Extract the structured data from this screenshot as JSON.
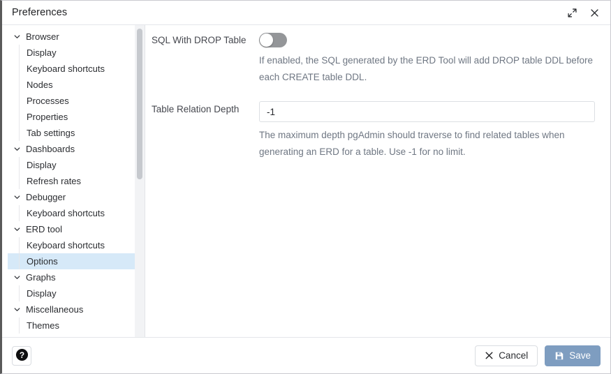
{
  "window": {
    "title": "Preferences",
    "expand_icon": "expand-icon",
    "close_icon": "close-icon"
  },
  "sidebar": {
    "tree": [
      {
        "label": "Browser",
        "type": "group",
        "expanded": true
      },
      {
        "label": "Display",
        "type": "child"
      },
      {
        "label": "Keyboard shortcuts",
        "type": "child"
      },
      {
        "label": "Nodes",
        "type": "child"
      },
      {
        "label": "Processes",
        "type": "child"
      },
      {
        "label": "Properties",
        "type": "child"
      },
      {
        "label": "Tab settings",
        "type": "child"
      },
      {
        "label": "Dashboards",
        "type": "group",
        "expanded": true
      },
      {
        "label": "Display",
        "type": "child"
      },
      {
        "label": "Refresh rates",
        "type": "child"
      },
      {
        "label": "Debugger",
        "type": "group",
        "expanded": true
      },
      {
        "label": "Keyboard shortcuts",
        "type": "child"
      },
      {
        "label": "ERD tool",
        "type": "group",
        "expanded": true
      },
      {
        "label": "Keyboard shortcuts",
        "type": "child"
      },
      {
        "label": "Options",
        "type": "child",
        "selected": true
      },
      {
        "label": "Graphs",
        "type": "group",
        "expanded": true
      },
      {
        "label": "Display",
        "type": "child"
      },
      {
        "label": "Miscellaneous",
        "type": "group",
        "expanded": true
      },
      {
        "label": "Themes",
        "type": "child"
      }
    ],
    "selected_accent": "#2c5f8e",
    "selected_background": "#d6e9f8"
  },
  "content": {
    "fields": [
      {
        "label": "SQL With DROP Table",
        "control": "toggle",
        "value": "off",
        "help": "If enabled, the SQL generated by the ERD Tool will add DROP table DDL before each CREATE table DDL."
      },
      {
        "label": "Table Relation Depth",
        "control": "text",
        "value": "-1",
        "placeholder": "",
        "help": "The maximum depth pgAdmin should traverse to find related tables when generating an ERD for a table. Use -1 for no limit."
      }
    ]
  },
  "footer": {
    "help_icon": "question-mark-icon",
    "cancel_label": "Cancel",
    "cancel_icon": "close-icon",
    "save_label": "Save",
    "save_icon": "save-disk-icon",
    "save_color": "#7e9dc0"
  }
}
